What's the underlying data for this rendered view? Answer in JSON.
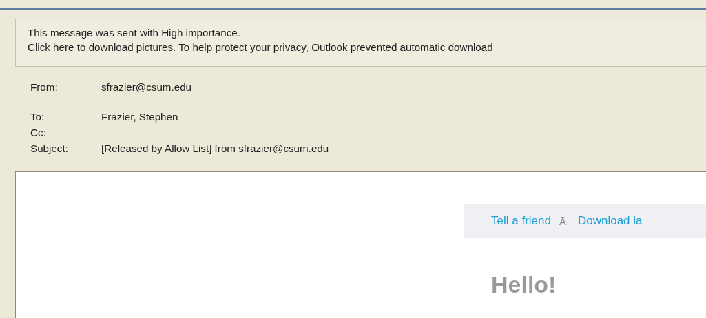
{
  "info_bar": {
    "lines": [
      "This message was sent with High importance.",
      "Click here to download pictures. To help protect your privacy, Outlook prevented automatic download"
    ]
  },
  "headers": [
    {
      "label": "From:",
      "value": "sfrazier@csum.edu"
    },
    {
      "label": "To:",
      "value": "Frazier, Stephen"
    },
    {
      "label": "Cc:"
    },
    {
      "label": "Subject:",
      "value": "[Released by Allow List] from sfrazier@csum.edu"
    }
  ],
  "body": {
    "links": [
      {
        "kind": "link",
        "text": "Tell a friend"
      },
      {
        "kind": "separator",
        "text": "Ā·"
      },
      {
        "kind": "link",
        "text": "Download la"
      }
    ],
    "heading": "Hello!"
  }
}
